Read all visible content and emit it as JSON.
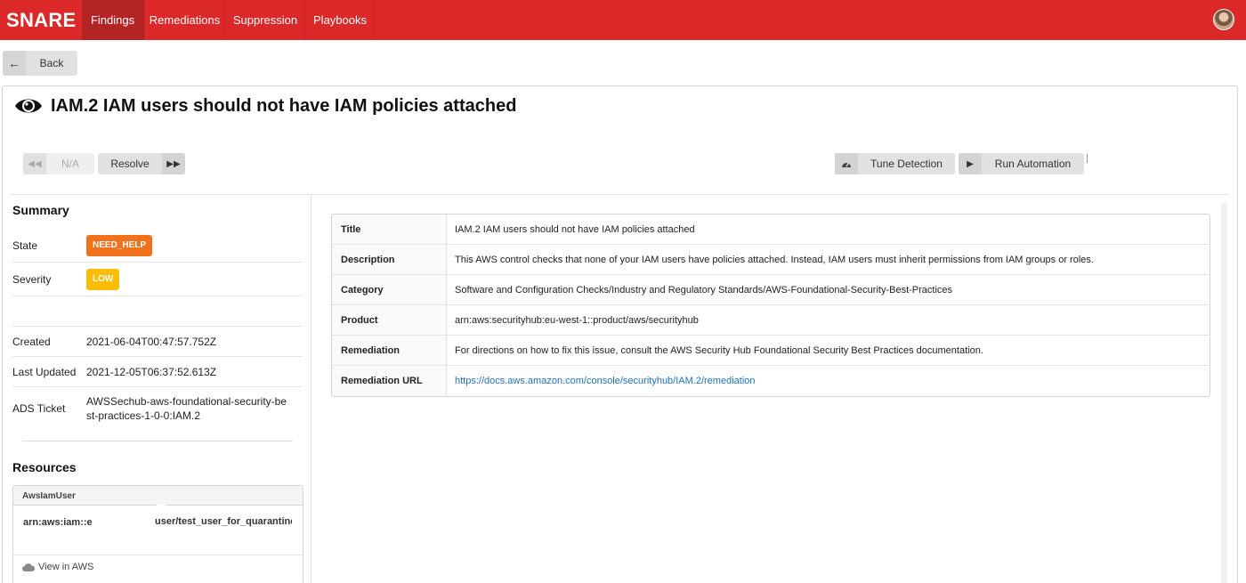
{
  "nav": {
    "brand": "SNARE",
    "items": [
      "Findings",
      "Remediations",
      "Suppression",
      "Playbooks"
    ]
  },
  "back_label": "Back",
  "page_title": "IAM.2 IAM users should not have IAM policies attached",
  "toolbar": {
    "na_label": "N/A",
    "resolve_label": "Resolve",
    "tune_label": "Tune Detection",
    "run_label": "Run Automation"
  },
  "summary": {
    "heading": "Summary",
    "state_label": "State",
    "state_value": "NEED_HELP",
    "severity_label": "Severity",
    "severity_value": "LOW",
    "created_label": "Created",
    "created_value": "2021-06-04T00:47:57.752Z",
    "updated_label": "Last Updated",
    "updated_value": "2021-12-05T06:37:52.613Z",
    "ticket_label": "ADS Ticket",
    "ticket_value": "AWSSechub-aws-foundational-security-best-practices-1-0-0:IAM.2"
  },
  "resources": {
    "heading": "Resources",
    "type": "AwsIamUser",
    "arn": "arn:aws:iam::e",
    "user": "user/test_user_for_quarantine",
    "view_label": "View in AWS"
  },
  "details": [
    {
      "label": "Title",
      "value": "IAM.2 IAM users should not have IAM policies attached"
    },
    {
      "label": "Description",
      "value": "This AWS control checks that none of your IAM users have policies attached. Instead, IAM users must inherit permissions from IAM groups or roles."
    },
    {
      "label": "Category",
      "value": "Software and Configuration Checks/Industry and Regulatory Standards/AWS-Foundational-Security-Best-Practices"
    },
    {
      "label": "Product",
      "value": "arn:aws:securityhub:eu-west-1::product/aws/securityhub"
    },
    {
      "label": "Remediation",
      "value": "For directions on how to fix this issue, consult the AWS Security Hub Foundational Security Best Practices documentation."
    },
    {
      "label": "Remediation URL",
      "value": "https://docs.aws.amazon.com/console/securityhub/IAM.2/remediation"
    }
  ],
  "colors": {
    "brand_red": "#db2828",
    "state_orange": "#f2711c",
    "severity_yellow": "#fbbd08",
    "link_blue": "#1e70bf"
  },
  "icons": [
    "eye-icon",
    "arrow-left-icon",
    "fast-backward-icon",
    "fast-forward-icon",
    "dashboard-icon",
    "play-icon",
    "cloud-icon"
  ]
}
